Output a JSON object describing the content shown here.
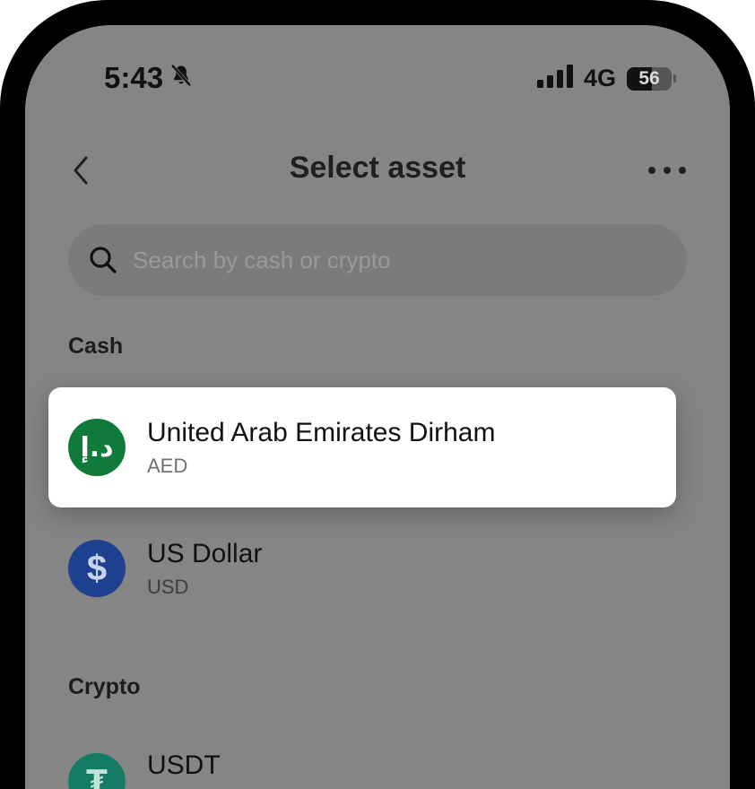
{
  "status_bar": {
    "time": "5:43",
    "network": "4G",
    "battery_level": "56",
    "battery_fraction": 0.56
  },
  "header": {
    "title": "Select asset"
  },
  "search": {
    "placeholder": "Search by cash or crypto",
    "value": ""
  },
  "sections": {
    "cash": {
      "label": "Cash",
      "items": [
        {
          "name": "United Arab Emirates Dirham",
          "code": "AED",
          "icon_glyph": "د.إ",
          "icon_color": "#0f7a3a",
          "selected": true
        },
        {
          "name": "US Dollar",
          "code": "USD",
          "icon_glyph": "$",
          "icon_color": "#1f3f8f",
          "selected": false
        }
      ]
    },
    "crypto": {
      "label": "Crypto",
      "items": [
        {
          "name": "USDT",
          "code": "",
          "icon_glyph": "₮",
          "icon_color": "#157a63",
          "selected": false
        }
      ]
    }
  },
  "colors": {
    "overlay_background": "#858585",
    "card_background": "#ffffff",
    "aed_green": "#0f7a3a",
    "usd_blue": "#1f3f8f",
    "usdt_teal": "#157a63"
  }
}
